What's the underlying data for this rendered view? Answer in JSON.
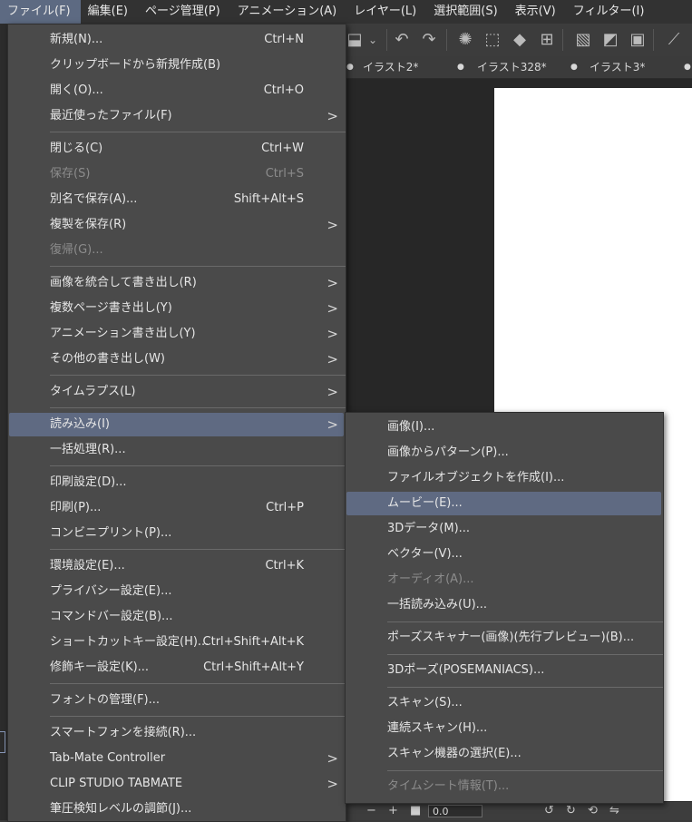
{
  "menubar": {
    "items": [
      {
        "label": "ファイル(F)"
      },
      {
        "label": "編集(E)"
      },
      {
        "label": "ページ管理(P)"
      },
      {
        "label": "アニメーション(A)"
      },
      {
        "label": "レイヤー(L)"
      },
      {
        "label": "選択範囲(S)"
      },
      {
        "label": "表示(V)"
      },
      {
        "label": "フィルター(I)"
      }
    ]
  },
  "tabs": [
    {
      "label": "イラスト2*"
    },
    {
      "label": "イラスト328*"
    },
    {
      "label": "イラスト3*"
    }
  ],
  "bottombar": {
    "zoom_value": "0.0"
  },
  "file_menu": {
    "items": [
      {
        "label": "新規(N)...",
        "shortcut": "Ctrl+N"
      },
      {
        "label": "クリップボードから新規作成(B)",
        "shortcut": ""
      },
      {
        "label": "開く(O)...",
        "shortcut": "Ctrl+O"
      },
      {
        "label": "最近使ったファイル(F)",
        "shortcut": ""
      },
      {
        "label": "閉じる(C)",
        "shortcut": "Ctrl+W"
      },
      {
        "label": "保存(S)",
        "shortcut": "Ctrl+S"
      },
      {
        "label": "別名で保存(A)...",
        "shortcut": "Shift+Alt+S"
      },
      {
        "label": "複製を保存(R)",
        "shortcut": ""
      },
      {
        "label": "復帰(G)...",
        "shortcut": ""
      },
      {
        "label": "画像を統合して書き出し(R)",
        "shortcut": ""
      },
      {
        "label": "複数ページ書き出し(Y)",
        "shortcut": ""
      },
      {
        "label": "アニメーション書き出し(Y)",
        "shortcut": ""
      },
      {
        "label": "その他の書き出し(W)",
        "shortcut": ""
      },
      {
        "label": "タイムラプス(L)",
        "shortcut": ""
      },
      {
        "label": "読み込み(I)",
        "shortcut": ""
      },
      {
        "label": "一括処理(R)...",
        "shortcut": ""
      },
      {
        "label": "印刷設定(D)...",
        "shortcut": ""
      },
      {
        "label": "印刷(P)...",
        "shortcut": "Ctrl+P"
      },
      {
        "label": "コンビニプリント(P)...",
        "shortcut": ""
      },
      {
        "label": "環境設定(E)...",
        "shortcut": "Ctrl+K"
      },
      {
        "label": "プライバシー設定(E)...",
        "shortcut": ""
      },
      {
        "label": "コマンドバー設定(B)...",
        "shortcut": ""
      },
      {
        "label": "ショートカットキー設定(H)...",
        "shortcut": "Ctrl+Shift+Alt+K"
      },
      {
        "label": "修飾キー設定(K)...",
        "shortcut": "Ctrl+Shift+Alt+Y"
      },
      {
        "label": "フォントの管理(F)...",
        "shortcut": ""
      },
      {
        "label": "スマートフォンを接続(R)...",
        "shortcut": ""
      },
      {
        "label": "Tab-Mate Controller",
        "shortcut": ""
      },
      {
        "label": "CLIP STUDIO TABMATE",
        "shortcut": ""
      },
      {
        "label": "筆圧検知レベルの調節(J)...",
        "shortcut": ""
      }
    ]
  },
  "import_submenu": {
    "items": [
      {
        "label": "画像(I)..."
      },
      {
        "label": "画像からパターン(P)..."
      },
      {
        "label": "ファイルオブジェクトを作成(I)..."
      },
      {
        "label": "ムービー(E)..."
      },
      {
        "label": "3Dデータ(M)..."
      },
      {
        "label": "ベクター(V)..."
      },
      {
        "label": "オーディオ(A)..."
      },
      {
        "label": "一括読み込み(U)..."
      },
      {
        "label": "ポーズスキャナー(画像)(先行プレビュー)(B)..."
      },
      {
        "label": "3Dポーズ(POSEMANIACS)..."
      },
      {
        "label": "スキャン(S)..."
      },
      {
        "label": "連続スキャン(H)..."
      },
      {
        "label": "スキャン機器の選択(E)..."
      },
      {
        "label": "タイムシート情報(T)..."
      }
    ]
  },
  "colors": {
    "menu_bg": "#4a4a4a",
    "highlight": "#5f6a82",
    "disabled_text": "#8c8c8c",
    "canvas_bg": "#272727"
  }
}
